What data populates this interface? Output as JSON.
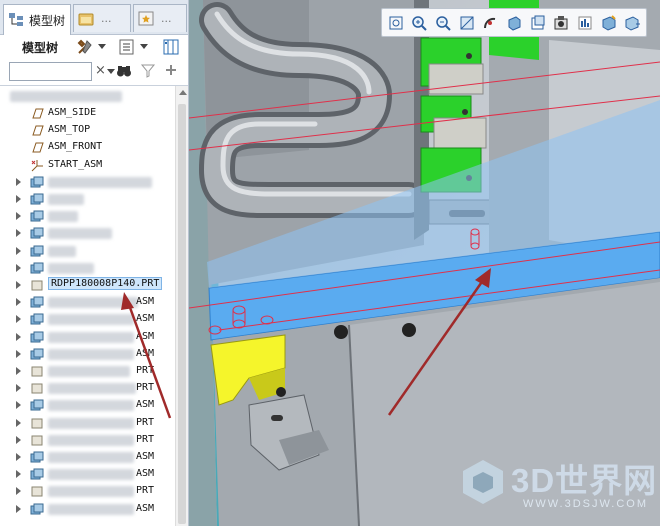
{
  "left_panel": {
    "tabs": [
      {
        "label": "模型树",
        "icon": "model-tree-icon"
      },
      {
        "label": "...",
        "icon": "folder-browser-icon"
      },
      {
        "label": "...",
        "icon": "favorites-icon"
      }
    ],
    "toolbar_label": "模型树",
    "search": {
      "value": "",
      "clear": "×"
    },
    "tree": {
      "items": [
        {
          "type": "plane",
          "label": "ASM_SIDE"
        },
        {
          "type": "plane",
          "label": "ASM_TOP"
        },
        {
          "type": "plane",
          "label": "ASM_FRONT"
        },
        {
          "type": "csys",
          "label": "START_ASM"
        },
        {
          "type": "asm",
          "label": ""
        },
        {
          "type": "asm",
          "label": ""
        },
        {
          "type": "asm",
          "label": ""
        },
        {
          "type": "asm",
          "label": ""
        },
        {
          "type": "asm",
          "label": ""
        },
        {
          "type": "asm",
          "label": ""
        },
        {
          "type": "prt",
          "label": "RDPP180008P140.PRT",
          "selected": true
        },
        {
          "type": "asm",
          "label": "",
          "suffix": "ASM"
        },
        {
          "type": "asm",
          "label": "",
          "suffix": "ASM"
        },
        {
          "type": "asm",
          "label": "",
          "suffix": "ASM"
        },
        {
          "type": "asm",
          "label": "",
          "suffix": "ASM"
        },
        {
          "type": "prt",
          "label": "",
          "suffix": "PRT"
        },
        {
          "type": "prt",
          "label": "",
          "suffix": "PRT"
        },
        {
          "type": "asm",
          "label": "",
          "suffix": "ASM"
        },
        {
          "type": "prt",
          "label": "",
          "suffix": "PRT"
        },
        {
          "type": "prt",
          "label": "",
          "suffix": "PRT"
        },
        {
          "type": "asm",
          "label": "",
          "suffix": "ASM"
        },
        {
          "type": "asm",
          "label": "",
          "suffix": "ASM"
        },
        {
          "type": "prt",
          "label": "",
          "suffix": "PRT"
        },
        {
          "type": "asm",
          "label": "",
          "suffix": "ASM"
        }
      ]
    }
  },
  "viewport": {
    "toolbar_icons": [
      "refit-icon",
      "zoom-in-icon",
      "zoom-out-icon",
      "repaint-icon",
      "spin-center-icon",
      "display-style-icon",
      "saved-views-icon",
      "view-manager-icon",
      "annotation-display-icon",
      "datum-display-icon",
      "more-views-icon"
    ],
    "watermark": {
      "text": "3D世界网",
      "url": "WWW.3DSJW.COM"
    },
    "colors": {
      "sheet_blue": "#5aabf0",
      "bracket_green": "#2bd12b",
      "block_yellow": "#f5f52b",
      "body_gray": "#aab0b6",
      "arrow_red": "#a02a2a"
    }
  }
}
